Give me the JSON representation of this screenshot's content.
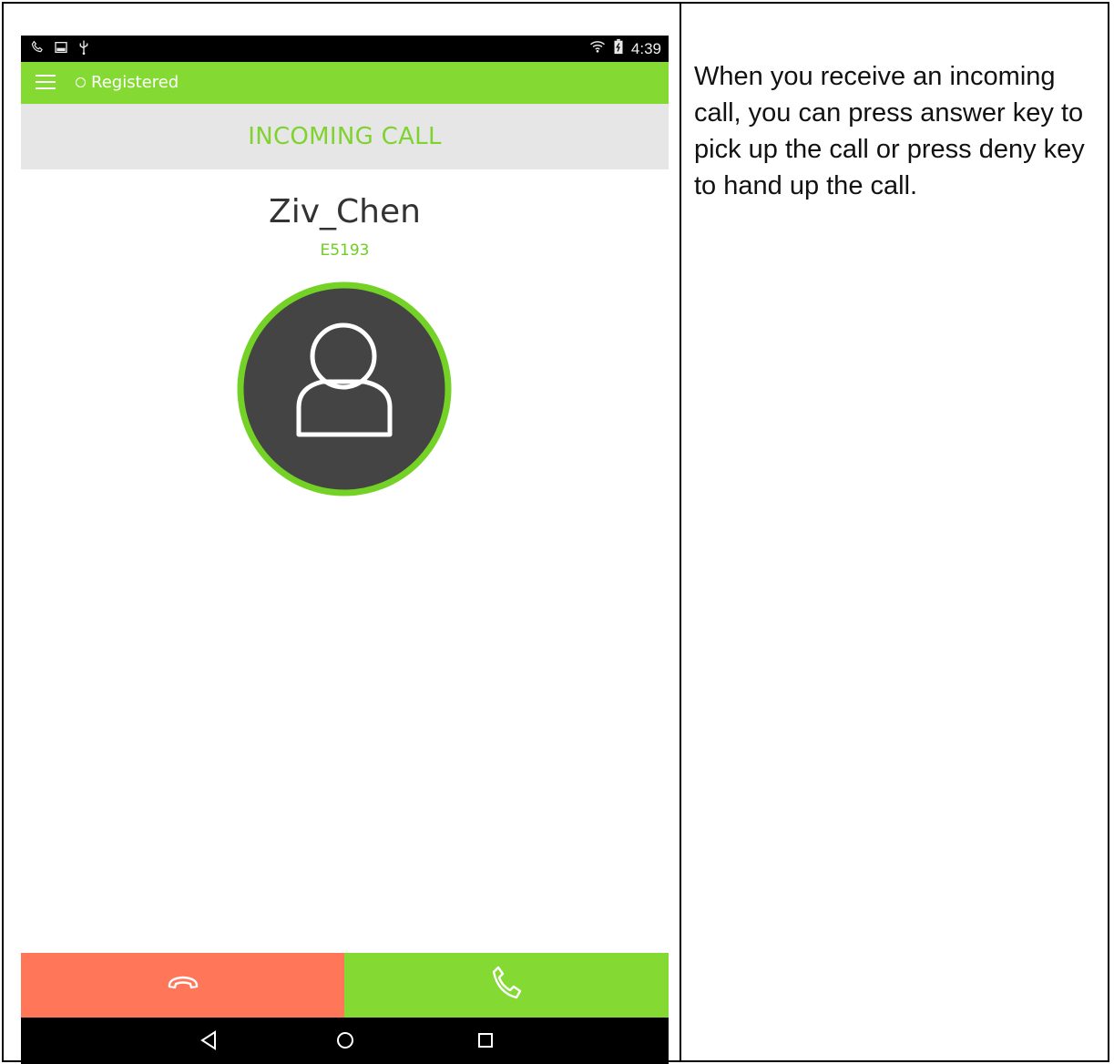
{
  "status_bar": {
    "time": "4:39",
    "left_icons": [
      "phone-icon",
      "image-icon",
      "usb-icon"
    ],
    "right_icons": [
      "wifi-icon",
      "battery-icon"
    ]
  },
  "app_bar": {
    "menu_icon": "hamburger-menu-icon",
    "registration_status": "Registered"
  },
  "call": {
    "banner": "INCOMING CALL",
    "caller_name": "Ziv_Chen",
    "caller_number": "E5193",
    "avatar_icon": "person-avatar-icon"
  },
  "actions": {
    "deny_icon": "hang-up-icon",
    "answer_icon": "answer-call-icon"
  },
  "nav_bar": {
    "icons": [
      "back-icon",
      "home-icon",
      "recents-icon"
    ]
  },
  "description": "When you receive an incoming call, you can press answer key to pick up the call or press deny key to hand up the call.",
  "colors": {
    "accent_green": "#84da33",
    "deny_red": "#ff7658",
    "avatar_dark": "#444444",
    "banner_gray": "#e6e6e6"
  }
}
